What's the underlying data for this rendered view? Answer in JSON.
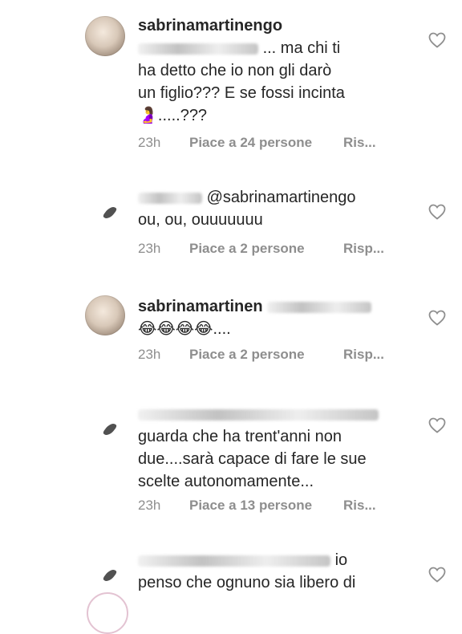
{
  "comments": [
    {
      "username": "sabrinamartinengo",
      "lines": [
        "... ma chi ti",
        "ha detto che io non gli darò",
        "un figlio??? E se fossi incinta",
        ".....???"
      ],
      "emoji": "🤰",
      "time": "23h",
      "likes": "Piace a 24 persone",
      "reply": "Ris..."
    },
    {
      "username": "",
      "lines": [
        "@sabrinamartinengo",
        "ou, ou, ouuuuuuu"
      ],
      "time": "23h",
      "likes": "Piace a 2 persone",
      "reply": "Risp..."
    },
    {
      "username": "sabrinamartinen",
      "lines": [
        "😂😂😂😂...."
      ],
      "time": "23h",
      "likes": "Piace a 2 persone",
      "reply": "Risp..."
    },
    {
      "username": "",
      "lines": [
        "guarda che ha trent'anni non",
        "due....sarà  capace di fare le sue",
        "scelte autonomamente..."
      ],
      "time": "23h",
      "likes": "Piace a 13 persone",
      "reply": "Ris..."
    },
    {
      "username": "",
      "lines": [
        "io",
        "penso che ognuno sia libero di"
      ]
    }
  ],
  "icons": {
    "like": "heart-outline-icon",
    "avatar_placeholder": "leaf-icon"
  },
  "colors": {
    "text": "#262626",
    "meta": "#8e8e8e",
    "heart": "#8e8e8e"
  }
}
